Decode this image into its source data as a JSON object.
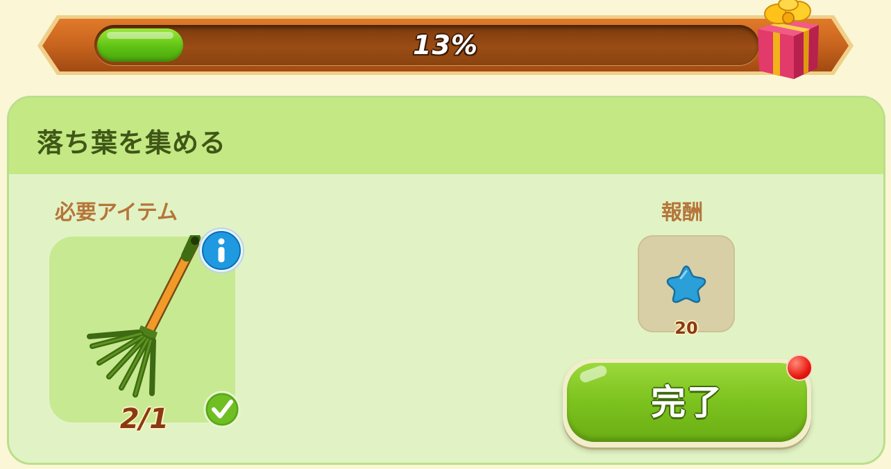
{
  "progress": {
    "percent_text": "13%",
    "fill_fraction": 0.13
  },
  "task": {
    "title": "落ち葉を集める",
    "required_label": "必要アイテム",
    "reward_label": "報酬",
    "required_item": {
      "icon": "rake-icon",
      "count_text": "2/1"
    },
    "reward_item": {
      "icon": "blue-star-icon",
      "amount": "20"
    },
    "complete_button": "完了"
  },
  "colors": {
    "banner": "#c8641e",
    "progress_fill": "#6ccc18",
    "panel": "#e1f3c5",
    "panel_header": "#c4e884",
    "title_text": "#3f5716",
    "label_text": "#b6753a",
    "button": "#7cc21e",
    "notification": "#e81a10"
  }
}
